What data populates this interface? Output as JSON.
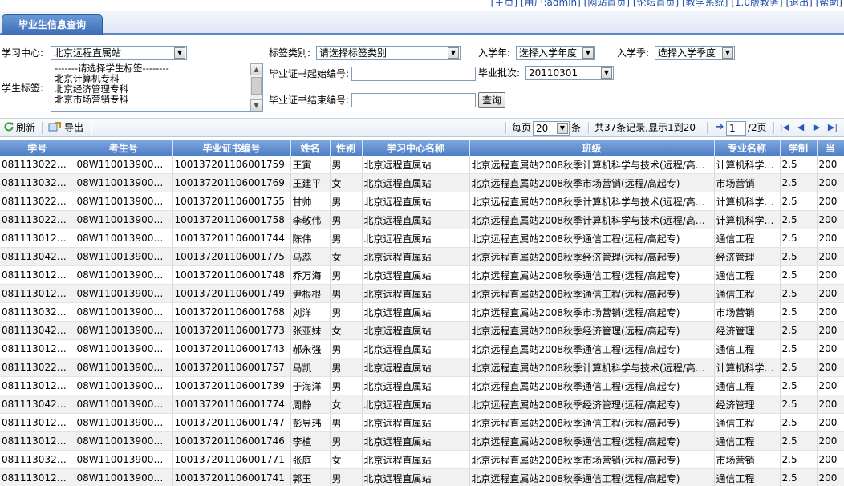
{
  "top_links": "[主页] [用户:admin] [网站首页] [论坛首页] [教学系统] [1.0版教务] [退出] [帮助]",
  "tab_label": "毕业生信息查询",
  "form": {
    "center_label": "学习中心:",
    "center_value": "北京远程直属站",
    "tag_type_label": "标签类别:",
    "tag_type_value": "请选择标签类别",
    "year_label": "入学年:",
    "year_value": "选择入学年度",
    "season_label": "入学季:",
    "season_value": "选择入学季度",
    "student_tag_label": "学生标签:",
    "student_tag_options": [
      "-------请选择学生标签--------",
      "北京计算机专科",
      "北京经济管理专科",
      "北京市场营销专科"
    ],
    "cert_start_label": "毕业证书起始编号:",
    "cert_end_label": "毕业证书结束编号:",
    "batch_label": "毕业批次:",
    "batch_value": "20110301",
    "query_button": "查询"
  },
  "toolbar": {
    "refresh": "刷新",
    "export": "导出",
    "per_page_prefix": "每页",
    "per_page_value": "20",
    "per_page_suffix": "条",
    "records_text": "共37条记录,显示1到20",
    "page_value": "1",
    "page_total": "/2页"
  },
  "columns": [
    "学号",
    "考生号",
    "毕业证书编号",
    "姓名",
    "性别",
    "学习中心名称",
    "班级",
    "专业名称",
    "学制",
    "当"
  ],
  "rows": [
    [
      "081113022…",
      "08W110013900…",
      "100137201106001759",
      "王寅",
      "男",
      "北京远程直属站",
      "北京远程直属站2008秋季计算机科学与技术(远程/高…",
      "计算机科学…",
      "2.5",
      "200"
    ],
    [
      "081113032…",
      "08W110013900…",
      "100137201106001769",
      "王建平",
      "女",
      "北京远程直属站",
      "北京远程直属站2008秋季市场营销(远程/高起专)",
      "市场营销",
      "2.5",
      "200"
    ],
    [
      "081113022…",
      "08W110013900…",
      "100137201106001755",
      "甘帅",
      "男",
      "北京远程直属站",
      "北京远程直属站2008秋季计算机科学与技术(远程/高…",
      "计算机科学…",
      "2.5",
      "200"
    ],
    [
      "081113022…",
      "08W110013900…",
      "100137201106001758",
      "李敬伟",
      "男",
      "北京远程直属站",
      "北京远程直属站2008秋季计算机科学与技术(远程/高…",
      "计算机科学…",
      "2.5",
      "200"
    ],
    [
      "081113012…",
      "08W110013900…",
      "100137201106001744",
      "陈伟",
      "男",
      "北京远程直属站",
      "北京远程直属站2008秋季通信工程(远程/高起专)",
      "通信工程",
      "2.5",
      "200"
    ],
    [
      "081113042…",
      "08W110013900…",
      "100137201106001775",
      "马蕊",
      "女",
      "北京远程直属站",
      "北京远程直属站2008秋季经济管理(远程/高起专)",
      "经济管理",
      "2.5",
      "200"
    ],
    [
      "081113012…",
      "08W110013900…",
      "100137201106001748",
      "乔万海",
      "男",
      "北京远程直属站",
      "北京远程直属站2008秋季通信工程(远程/高起专)",
      "通信工程",
      "2.5",
      "200"
    ],
    [
      "081113012…",
      "08W110013900…",
      "100137201106001749",
      "尹根根",
      "男",
      "北京远程直属站",
      "北京远程直属站2008秋季通信工程(远程/高起专)",
      "通信工程",
      "2.5",
      "200"
    ],
    [
      "081113032…",
      "08W110013900…",
      "100137201106001768",
      "刘洋",
      "男",
      "北京远程直属站",
      "北京远程直属站2008秋季市场营销(远程/高起专)",
      "市场营销",
      "2.5",
      "200"
    ],
    [
      "081113042…",
      "08W110013900…",
      "100137201106001773",
      "张亚妹",
      "女",
      "北京远程直属站",
      "北京远程直属站2008秋季经济管理(远程/高起专)",
      "经济管理",
      "2.5",
      "200"
    ],
    [
      "081113012…",
      "08W110013900…",
      "100137201106001743",
      "郝永强",
      "男",
      "北京远程直属站",
      "北京远程直属站2008秋季通信工程(远程/高起专)",
      "通信工程",
      "2.5",
      "200"
    ],
    [
      "081113022…",
      "08W110013900…",
      "100137201106001757",
      "马凯",
      "男",
      "北京远程直属站",
      "北京远程直属站2008秋季计算机科学与技术(远程/高…",
      "计算机科学…",
      "2.5",
      "200"
    ],
    [
      "081113012…",
      "08W110013900…",
      "100137201106001739",
      "于海洋",
      "男",
      "北京远程直属站",
      "北京远程直属站2008秋季通信工程(远程/高起专)",
      "通信工程",
      "2.5",
      "200"
    ],
    [
      "081113042…",
      "08W110013900…",
      "100137201106001774",
      "周静",
      "女",
      "北京远程直属站",
      "北京远程直属站2008秋季经济管理(远程/高起专)",
      "经济管理",
      "2.5",
      "200"
    ],
    [
      "081113012…",
      "08W110013900…",
      "100137201106001747",
      "彭昱玮",
      "男",
      "北京远程直属站",
      "北京远程直属站2008秋季通信工程(远程/高起专)",
      "通信工程",
      "2.5",
      "200"
    ],
    [
      "081113012…",
      "08W110013900…",
      "100137201106001746",
      "李植",
      "男",
      "北京远程直属站",
      "北京远程直属站2008秋季通信工程(远程/高起专)",
      "通信工程",
      "2.5",
      "200"
    ],
    [
      "081113032…",
      "08W110013900…",
      "100137201106001771",
      "张庭",
      "女",
      "北京远程直属站",
      "北京远程直属站2008秋季市场营销(远程/高起专)",
      "市场营销",
      "2.5",
      "200"
    ],
    [
      "081113012…",
      "08W110013900…",
      "100137201106001741",
      "郭玉",
      "男",
      "北京远程直属站",
      "北京远程直属站2008秋季通信工程(远程/高起专)",
      "通信工程",
      "2.5",
      "200"
    ]
  ]
}
